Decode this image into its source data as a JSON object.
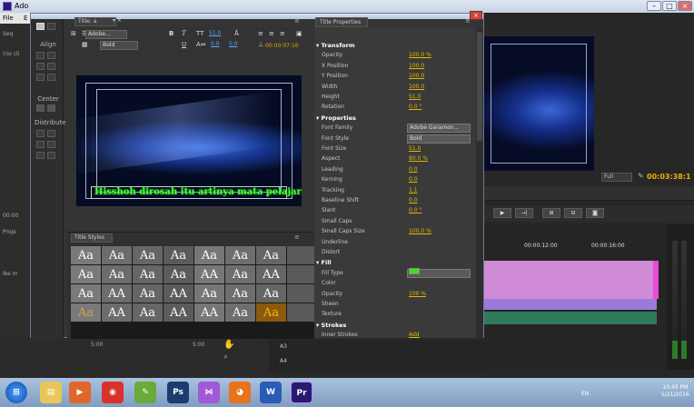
{
  "app": {
    "title": "Ado",
    "menu": [
      "File",
      "E"
    ]
  },
  "left_strip": {
    "labels": [
      "Seq",
      "(no cli",
      "Proje",
      "Ike m",
      "00:00"
    ]
  },
  "title_designer": {
    "tab": "Title: a",
    "font": "Adobe...",
    "style": "Bold",
    "font_size": "51.0",
    "kerning": "0.0",
    "leading": "0.0",
    "timecode": "00:00:07:16",
    "tools": {
      "align": "Align",
      "center": "Center",
      "distribute": "Distribute"
    },
    "title_text": "Hisshoh dirosah itu artinya mata pelajaran"
  },
  "title_styles": {
    "tab": "Title Styles",
    "swatches": [
      "Aa",
      "Aa",
      "Aa",
      "Aa",
      "Aa",
      "Aa",
      "Aa",
      "",
      "Aa",
      "Aa",
      "Aa",
      "Aa",
      "AA",
      "Aa",
      "AA",
      "",
      "Aa",
      "AA",
      "Aa",
      "AA",
      "Aa",
      "Aa",
      "Aa",
      "",
      "Aa",
      "AA",
      "Aa",
      "AA",
      "AA",
      "Aa",
      "Aa",
      ""
    ]
  },
  "properties": {
    "tab": "Title Properties",
    "rows": [
      {
        "name": "Transform",
        "section": true
      },
      {
        "name": "Opacity",
        "value": "100.0 %"
      },
      {
        "name": "X Position",
        "value": "100.0"
      },
      {
        "name": "Y Position",
        "value": "100.0"
      },
      {
        "name": "Width",
        "value": "100.0"
      },
      {
        "name": "Height",
        "value": "51.0"
      },
      {
        "name": "Rotation",
        "value": "0.0 °"
      },
      {
        "name": "Properties",
        "section": true
      },
      {
        "name": "Font Family",
        "dropdown": "Adobe Garamon..."
      },
      {
        "name": "Font Style",
        "dropdown": "Bold"
      },
      {
        "name": "Font Size",
        "value": "51.0"
      },
      {
        "name": "Aspect",
        "value": "80.0 %"
      },
      {
        "name": "Leading",
        "value": "0.0"
      },
      {
        "name": "Kerning",
        "value": "0.0"
      },
      {
        "name": "Tracking",
        "value": "1.1"
      },
      {
        "name": "Baseline Shift",
        "value": "0.0"
      },
      {
        "name": "Slant",
        "value": "0.0 °"
      },
      {
        "name": "Small Caps",
        "value": ""
      },
      {
        "name": "Small Caps Size",
        "value": "100.0 %"
      },
      {
        "name": "Underline",
        "value": ""
      },
      {
        "name": "Distort",
        "value": ""
      },
      {
        "name": "Fill",
        "section": true
      },
      {
        "name": "Fill Type",
        "dropdown": ""
      },
      {
        "name": "Color",
        "value": ""
      },
      {
        "name": "Opacity",
        "value": "100 %"
      },
      {
        "name": "Sheen",
        "value": ""
      },
      {
        "name": "Texture",
        "value": ""
      },
      {
        "name": "Strokes",
        "section": true
      },
      {
        "name": "Inner Strokes",
        "value": "Add"
      }
    ]
  },
  "program": {
    "fit": "Full",
    "timecode": "00:03:38:1"
  },
  "timeline": {
    "tc1": "00:00:12:00",
    "tc2": "00:00:16:00",
    "tracks": [
      "A3",
      "A4"
    ]
  },
  "bottom": {
    "tc_left": "5:00",
    "tc_right": "5:00"
  },
  "colors": {
    "fill_color": "#39e51a",
    "title_text": "#4dff3a"
  },
  "taskbar": {
    "lang": "EN",
    "time": "10:45 PM",
    "date": "5/21/2016"
  }
}
